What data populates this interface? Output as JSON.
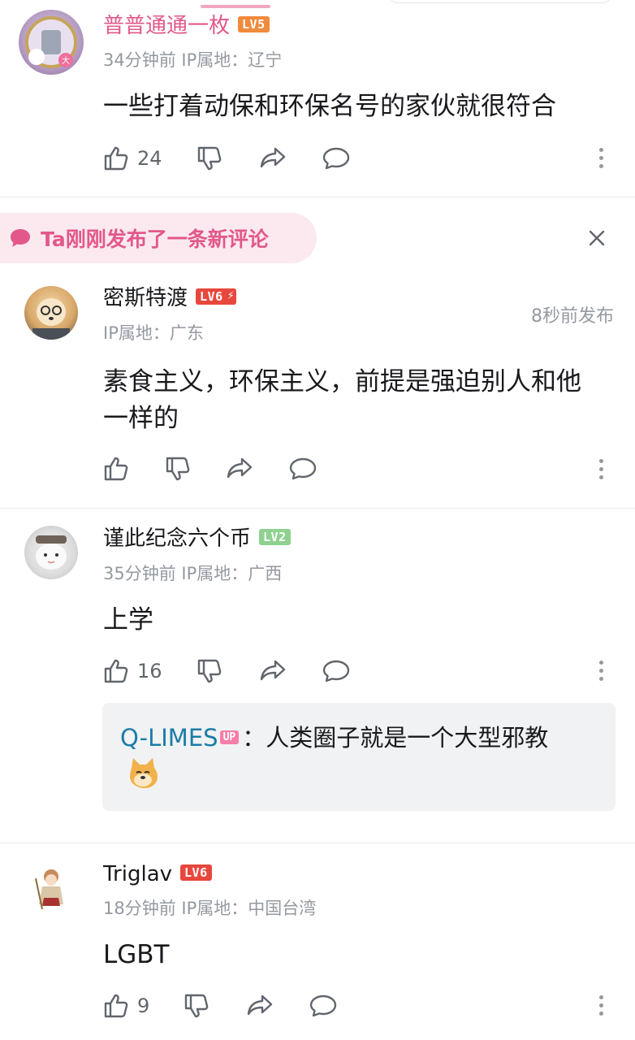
{
  "colors": {
    "lv5": "#f08a3c",
    "lv6": "#e8473d",
    "lv2": "#8fd18f",
    "pink": "#e2588a",
    "up_badge": "#f77ca8"
  },
  "icons": [
    "like-icon",
    "dislike-icon",
    "share-icon",
    "reply-icon",
    "more-icon",
    "close-icon",
    "speech-bubble-icon"
  ],
  "comments": [
    {
      "username": "普普通通一枚",
      "level": "LV5",
      "meta": "34分钟前 IP属地：辽宁",
      "text": "一些打着动保和环保名号的家伙就很符合",
      "likes": "24"
    },
    {
      "username": "谨此纪念六个币",
      "level": "LV2",
      "meta": "35分钟前 IP属地：广西",
      "text": "上学",
      "likes": "16",
      "reply": {
        "user": "Q-LIMES",
        "badge": "UP",
        "text": "：人类圈子就是一个大型邪教"
      }
    },
    {
      "username": "Triglav",
      "level": "LV6",
      "meta": "18分钟前 IP属地：中国台湾",
      "text": "LGBT",
      "likes": "9"
    }
  ],
  "new_comment_banner": {
    "text": "Ta刚刚发布了一条新评论",
    "username": "密斯特渡",
    "level": "LV6",
    "meta": "IP属地：广东",
    "time": "8秒前发布",
    "text_line1": "素食主义，环保主义，前提是强迫别人和他",
    "text_line2": "一样的"
  }
}
